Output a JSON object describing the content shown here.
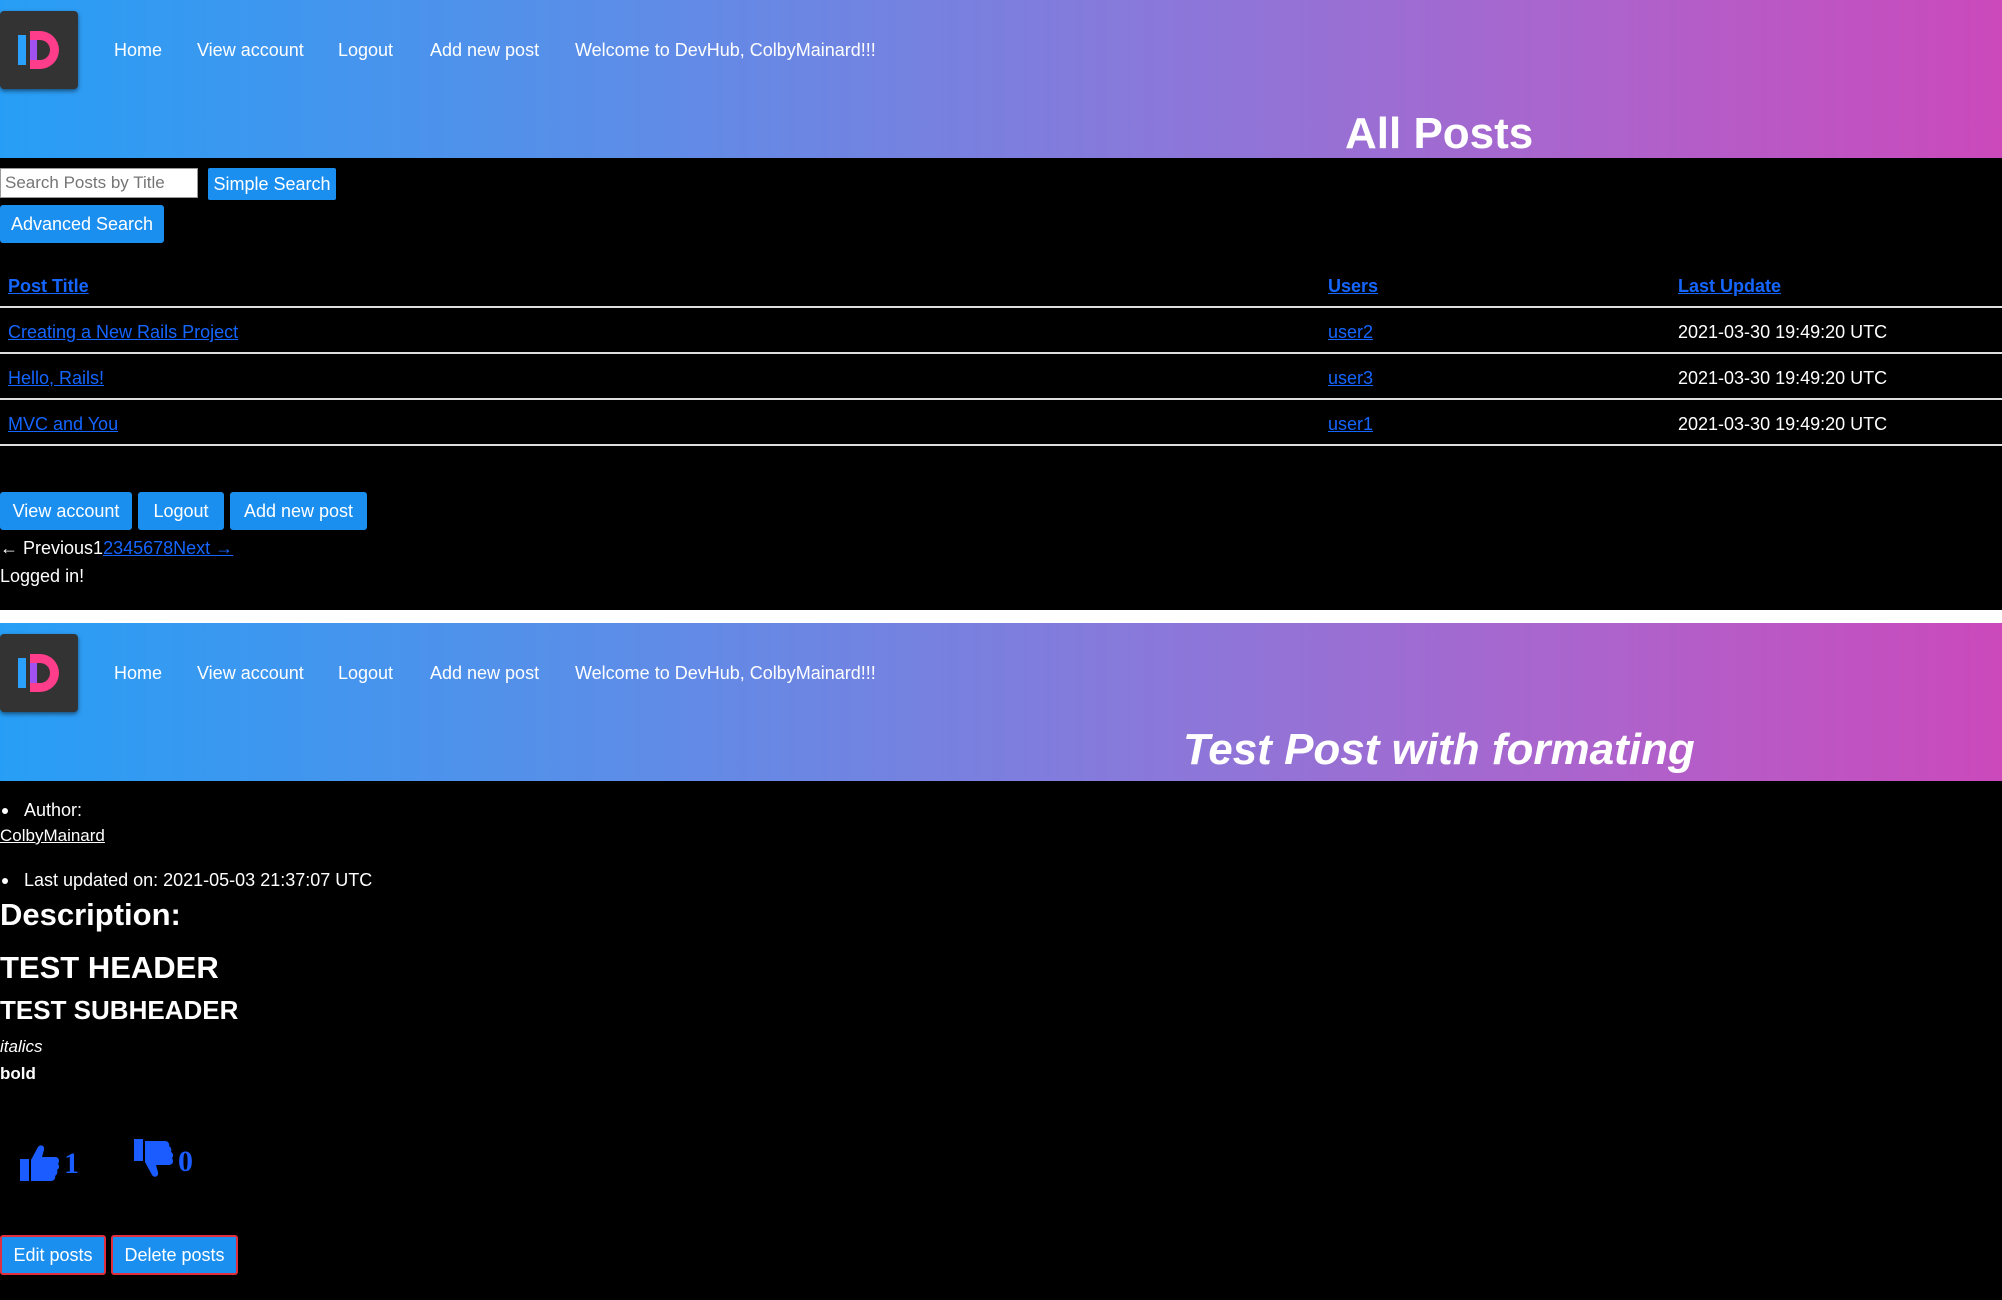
{
  "nav": {
    "home": "Home",
    "view_account": "View account",
    "logout": "Logout",
    "add_new_post": "Add new post",
    "welcome": "Welcome to DevHub, ColbyMainard!!!"
  },
  "index_page": {
    "heading": "All Posts",
    "search": {
      "placeholder": "Search Posts by Title",
      "value": ""
    },
    "simple_search_label": "Simple Search",
    "advanced_search_label": "Advanced Search",
    "table": {
      "headers": [
        "Post Title",
        "Users",
        "Last Update"
      ],
      "rows": [
        {
          "title": "Creating a New Rails Project",
          "user": "user2",
          "updated": "2021-03-30 19:49:20 UTC"
        },
        {
          "title": "Hello, Rails!",
          "user": "user3",
          "updated": "2021-03-30 19:49:20 UTC"
        },
        {
          "title": "MVC and You",
          "user": "user1",
          "updated": "2021-03-30 19:49:20 UTC"
        }
      ]
    },
    "footer_buttons": {
      "view_account": "View account",
      "logout": "Logout",
      "add_new_post": "Add new post"
    },
    "pagination": {
      "previous": "← Previous",
      "current": "1",
      "pages": [
        "2",
        "3",
        "4",
        "5",
        "6",
        "7",
        "8"
      ],
      "next": "Next →"
    },
    "status": "Logged in!"
  },
  "post_page": {
    "title": "Test Post with formating",
    "author_label": "Author:",
    "author_name": "ColbyMainard",
    "last_updated": "Last updated on: 2021-05-03 21:37:07 UTC",
    "description_label": "Description:",
    "content": {
      "header": "TEST HEADER",
      "subheader": "TEST SUBHEADER",
      "italics": "italics",
      "bold": "bold"
    },
    "likes": "1",
    "dislikes": "0",
    "edit_label": "Edit posts",
    "delete_label": "Delete posts"
  },
  "colors": {
    "gradient_start": "#279ef5",
    "gradient_end": "#cb49bb",
    "button": "#1a8ff0",
    "link": "#1565ff",
    "background": "#000000"
  }
}
